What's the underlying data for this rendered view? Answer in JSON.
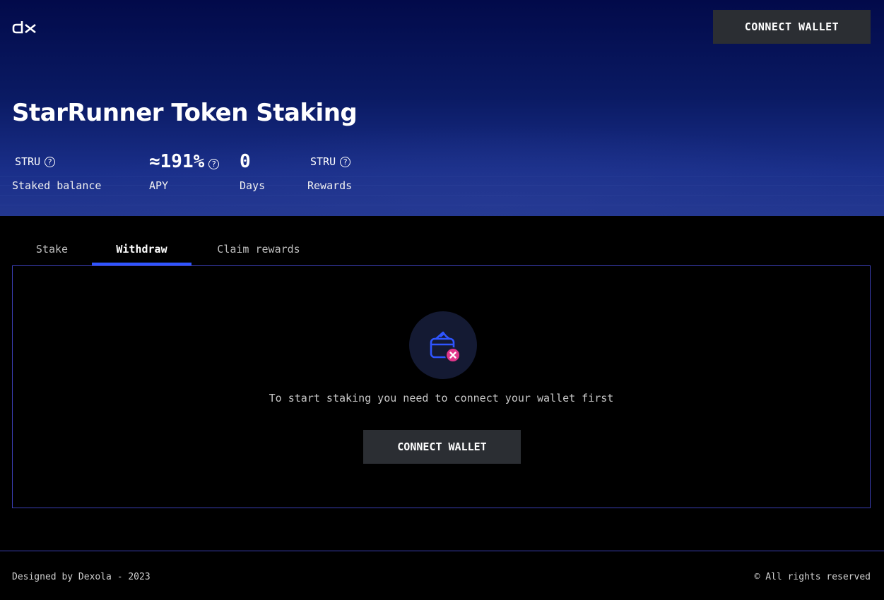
{
  "header": {
    "logo_icon": "dx-logo",
    "connect_label": "CONNECT WALLET"
  },
  "hero": {
    "title": "StarRunner Token Staking",
    "stats": [
      {
        "value": "STRU",
        "label": "Staked balance",
        "icon": "help-circle-icon"
      },
      {
        "value": "≈191%",
        "label": "APY",
        "icon": "help-circle-icon"
      },
      {
        "value": "0",
        "label": "Days"
      },
      {
        "value": "STRU",
        "label": "Rewards",
        "icon": "help-circle-icon"
      }
    ]
  },
  "tabs": [
    {
      "label": "Stake",
      "active": false
    },
    {
      "label": "Withdraw",
      "active": true
    },
    {
      "label": "Claim rewards",
      "active": false
    }
  ],
  "panel": {
    "icon": "wallet-disconnected-icon",
    "message": "To start staking you need to connect your wallet first",
    "connect_label": "CONNECT WALLET"
  },
  "footer": {
    "left": "Designed by Dexola - 2023",
    "right": "© All rights reserved"
  },
  "colors": {
    "accent": "#2f55ff",
    "border": "#3b3fb5",
    "button_bg": "#2b2e33",
    "alert": "#e0368a"
  }
}
